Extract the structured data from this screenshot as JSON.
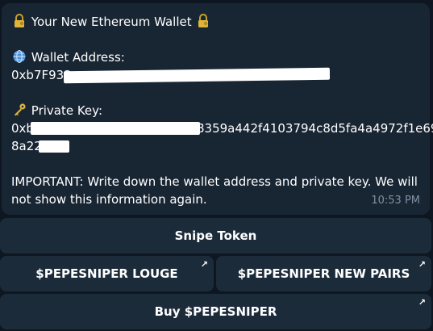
{
  "message": {
    "title": "Your New Ethereum Wallet",
    "address_label": "Wallet Address:",
    "address_value_visible_start": "0xb7F932",
    "private_key_label": "Private Key:",
    "private_key_line1_start": "0xb",
    "private_key_line1_end": "8359a442f4103794c8d5fa4a4972f1e69",
    "private_key_line2_start": "8a22",
    "important_line1": "IMPORTANT: Write down the wallet address and private key. We will",
    "important_line2": "not show this information again.",
    "timestamp": "10:53 PM"
  },
  "buttons": {
    "snipe": "Snipe Token",
    "lounge": "$PEPESNIPER LOUGE",
    "new_pairs": "$PEPESNIPER NEW PAIRS",
    "buy": "Buy $PEPESNIPER"
  },
  "icons": {
    "title_left": "lock-with-key-icon",
    "title_right": "lock-with-key-icon",
    "address": "globe-icon",
    "key": "key-icon",
    "external_link": "external-arrow-icon"
  },
  "colors": {
    "background": "#0e1621",
    "bubble": "#182533",
    "button": "#1c2b3a",
    "timestamp": "#7f91a4"
  }
}
